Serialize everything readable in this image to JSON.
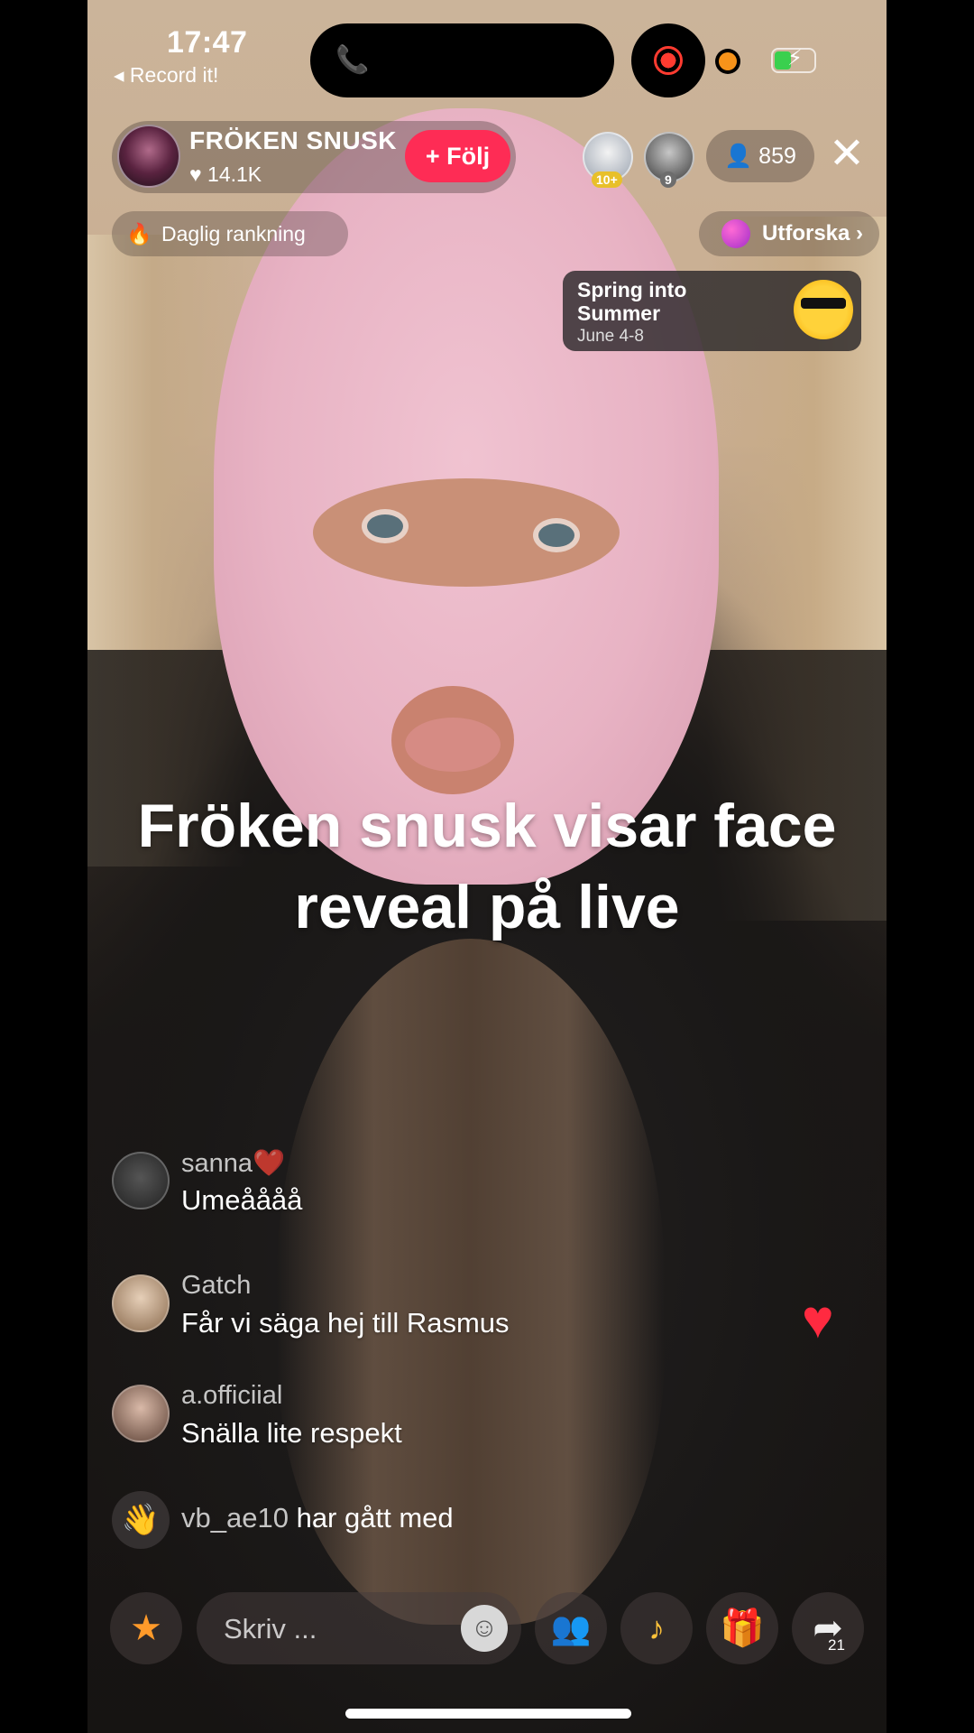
{
  "status": {
    "time": "17:47",
    "back_label": "◂ Record it!"
  },
  "host": {
    "name": "FRÖKEN SNUSK",
    "likes": "♥ 14.1K",
    "follow_label": "+ Följ"
  },
  "viewers": {
    "badge_1": "10+",
    "badge_2": "9",
    "count": "👤 859"
  },
  "pills": {
    "daily_ranking": "Daglig rankning",
    "explore": "Utforska ›"
  },
  "promo": {
    "title": "Spring into Summer",
    "date": "June 4-8"
  },
  "caption": "Fröken snusk visar face reveal på live",
  "chat": [
    {
      "user": "sanna❤️",
      "message": "Umeåååå"
    },
    {
      "user": "Gatch",
      "message": "Får vi säga hej till Rasmus"
    },
    {
      "user": "a.officiial",
      "message": "Snälla lite respekt"
    }
  ],
  "joined": {
    "user": "vb_ae10",
    "text": "har gått med"
  },
  "bottom": {
    "input_placeholder": "Skriv ...",
    "share_count": "21"
  },
  "colors": {
    "follow": "#fe2c55",
    "accent_green": "#3ad04e",
    "record": "#ff3b30"
  }
}
